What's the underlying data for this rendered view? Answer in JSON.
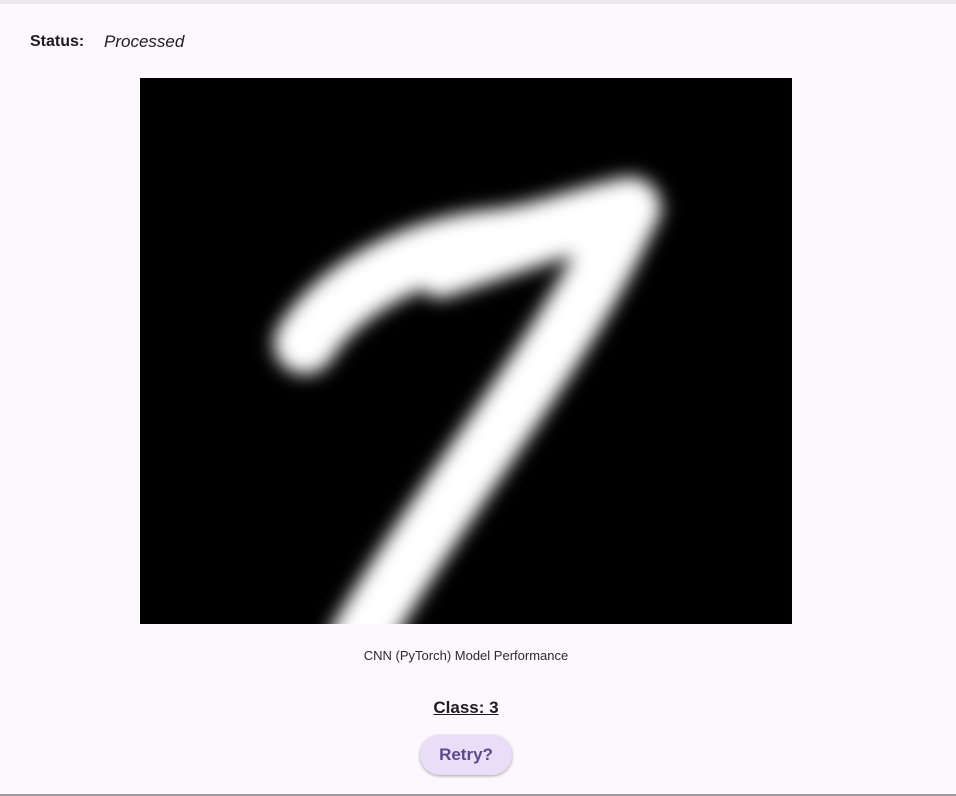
{
  "status": {
    "label": "Status:",
    "value": "Processed"
  },
  "digit_image": {
    "description_icon": "handwritten-digit-image"
  },
  "caption": "CNN (PyTorch) Model Performance",
  "result": {
    "text": "Class: 3"
  },
  "retry_button": {
    "label": "Retry?"
  },
  "colors": {
    "background": "#fdf8fd",
    "button_bg": "#e8def8",
    "button_text": "#5b4a8a"
  }
}
